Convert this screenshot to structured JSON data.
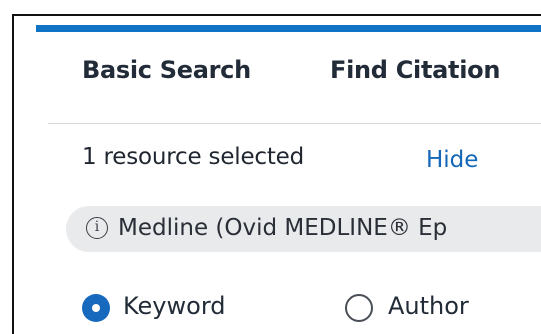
{
  "tabs": {
    "basic_search": "Basic Search",
    "find_citation": "Find Citation"
  },
  "resources": {
    "selected_text": "1 resource selected",
    "hide_label": "Hide",
    "chip_label": "Medline (Ovid MEDLINE® Ep",
    "chip_icon": "info-icon"
  },
  "search_type": {
    "options": [
      {
        "label": "Keyword",
        "selected": true
      },
      {
        "label": "Author",
        "selected": false
      }
    ]
  },
  "colors": {
    "accent": "#1173c5",
    "link": "#1467b8",
    "chip_bg": "#e9eaec"
  }
}
